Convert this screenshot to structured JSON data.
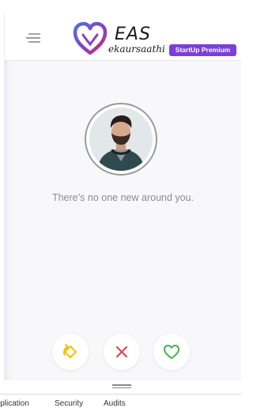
{
  "header": {
    "logo_title": "EAS",
    "logo_subtitle": "ekaursaathi",
    "badge": "StartUp Premium"
  },
  "main": {
    "empty_message": "There’s no one new around you."
  },
  "actions": [
    {
      "icon": "rewind-icon",
      "color": "#f2c200"
    },
    {
      "icon": "close-icon",
      "color": "#e0474c"
    },
    {
      "icon": "heart-icon",
      "color": "#3bb54a"
    }
  ],
  "colors": {
    "accent": "#7b3fd9",
    "logo_heart_from": "#5a6ad8",
    "logo_heart_to": "#c0327f"
  },
  "devtools_tabs": [
    "Application",
    "Security",
    "Audits"
  ]
}
